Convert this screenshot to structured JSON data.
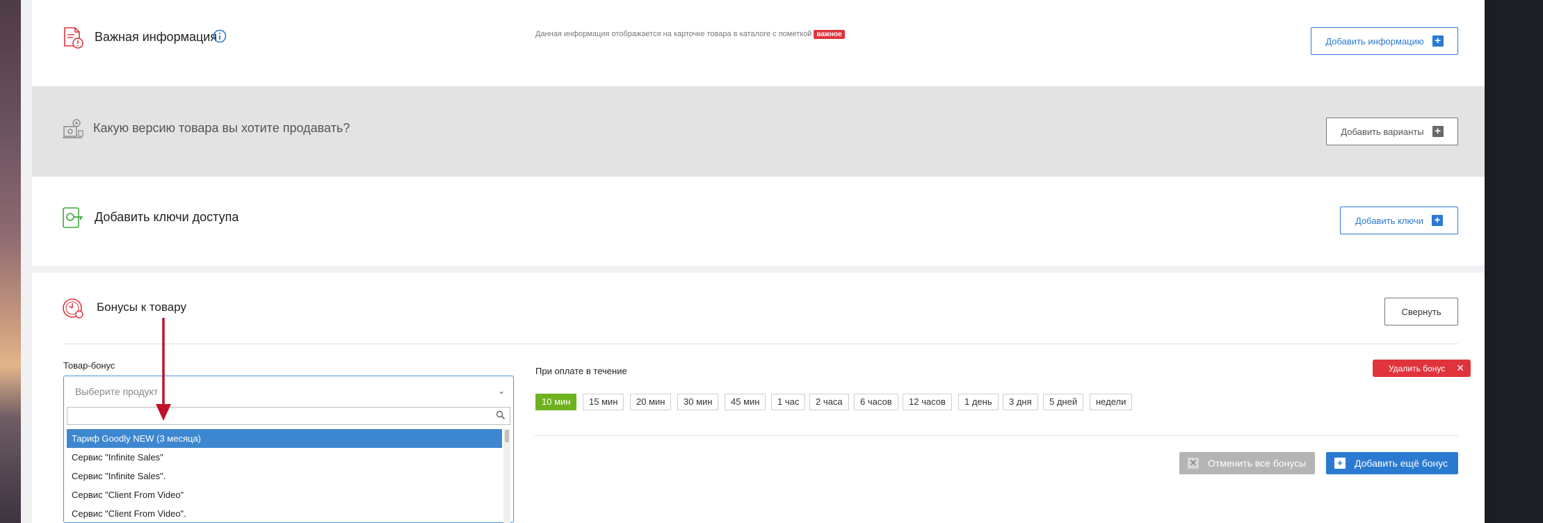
{
  "sections": {
    "important": {
      "title": "Важная информация",
      "note": "Данная информация отображается на карточке товара в каталоге с пометкой",
      "badge": "важное",
      "button": "Добавить информацию"
    },
    "versions": {
      "title": "Какую версию товара вы хотите продавать?",
      "button": "Добавить варианты"
    },
    "keys": {
      "title": "Добавить ключи доступа",
      "button": "Добавить ключи"
    },
    "bonuses": {
      "title": "Бонусы к товару",
      "collapse_button": "Свернуть",
      "bonus_product_label": "Товар-бонус",
      "select_placeholder": "Выберите продукт",
      "dropdown_items": [
        "Тариф Goodly NEW (3 месяца)",
        "Сервис \"Infinite Sales\"",
        "Сервис \"Infinite Sales\".",
        "Сервис \"Client From Video\"",
        "Сервис \"Client From Video\"."
      ],
      "payment_label": "При оплате в течение",
      "time_options": [
        "10 мин",
        "15 мин",
        "20 мин",
        "30 мин",
        "45 мин",
        "1 час",
        "2 часа",
        "6 часов",
        "12 часов",
        "1 день",
        "3 дня",
        "5 дней",
        "недели"
      ],
      "selected_time": "10 мин",
      "delete_button": "Удалить бонус",
      "cancel_all_button": "Отменить все бонусы",
      "add_more_button": "Добавить ещё бонус"
    }
  },
  "colors": {
    "accent": "#2a7ad2",
    "danger": "#e0343d",
    "active_chip": "#6eb21f",
    "selected_row": "#3d87d0",
    "arrow": "#c0122a"
  }
}
